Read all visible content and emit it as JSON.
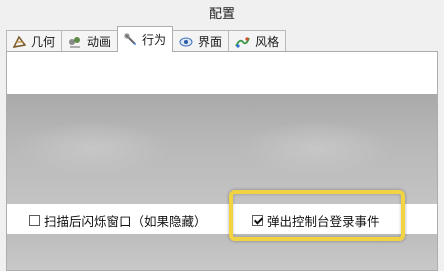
{
  "window": {
    "title": "配置"
  },
  "tabs": [
    {
      "label": "几何",
      "icon": "geometry-icon",
      "active": false
    },
    {
      "label": "动画",
      "icon": "animation-icon",
      "active": false
    },
    {
      "label": "行为",
      "icon": "behavior-icon",
      "active": true
    },
    {
      "label": "界面",
      "icon": "eye-icon",
      "active": false
    },
    {
      "label": "风格",
      "icon": "style-icon",
      "active": false
    }
  ],
  "options": {
    "flash_after_scan": {
      "label": "扫描后闪烁窗口（如果隐藏）",
      "checked": false
    },
    "popup_console_login": {
      "label": "弹出控制台登录事件",
      "checked": true
    }
  },
  "colors": {
    "highlight": "#f2d341",
    "pane_bg": "#ffffff",
    "blurred_area": "#b5b5b5"
  }
}
